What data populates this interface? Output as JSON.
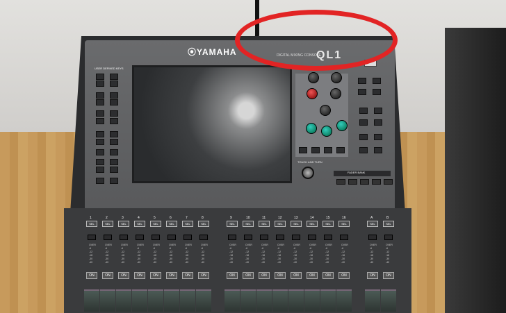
{
  "console": {
    "brand": "⦿YAMAHA",
    "model": "QL1",
    "subtitle": "DIGITAL MIXING CONSOLE"
  },
  "labels": {
    "user_defined_keys": "USER DEFINED KEYS",
    "touch_and_turn": "TOUCH AND TURN",
    "fader_bank": "FADER BANK"
  },
  "channels": [
    "1",
    "2",
    "3",
    "4",
    "5",
    "6",
    "7",
    "8",
    "9",
    "10",
    "11",
    "12",
    "13",
    "14",
    "15",
    "16",
    "A",
    "B"
  ],
  "strip": {
    "sel_label": "SEL",
    "on_label": "ON",
    "meter_text": "OVER\n-6\n-12\n-18\n-30\n-40"
  },
  "annotation": {
    "color": "#e22424"
  }
}
